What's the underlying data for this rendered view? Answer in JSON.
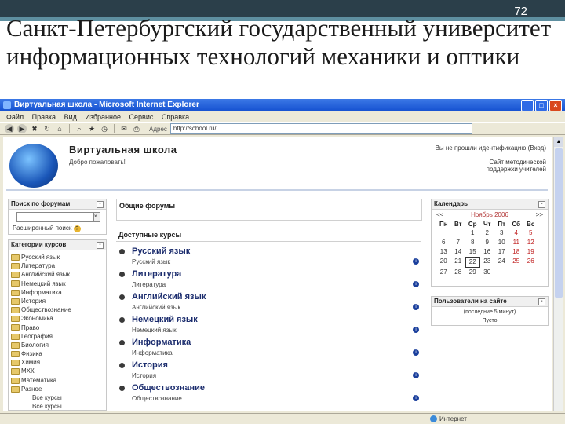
{
  "slide": {
    "number": "72",
    "title": "Санкт-Петербургский государственный университет информационных технологий механики и оптики"
  },
  "browser": {
    "window_title": "Виртуальная школа - Microsoft Internet Explorer",
    "menu": [
      "Файл",
      "Правка",
      "Вид",
      "Избранное",
      "Сервис",
      "Справка"
    ],
    "address_label": "Адрес",
    "address_value": "http://school.ru/",
    "status_zone": "Интернет"
  },
  "site": {
    "title": "Виртуальная школа",
    "welcome": "Добро пожаловать!",
    "login_info": "Вы не прошли идентификацию (Вход)",
    "support_link": "Сайт методической поддержки учителей"
  },
  "search_block": {
    "title": "Поиск по форумам",
    "go": "»",
    "advanced": "Расширенный поиск"
  },
  "categories_block": {
    "title": "Категории курсов",
    "items": [
      "Русский язык",
      "Литература",
      "Английский язык",
      "Немецкий язык",
      "Информатика",
      "История",
      "Обществознание",
      "Экономика",
      "Право",
      "География",
      "Биология",
      "Физика",
      "Химия",
      "МХК",
      "Математика",
      "Разное"
    ],
    "sub_items": [
      "Все курсы",
      "Все курсы..."
    ]
  },
  "center": {
    "forums_title": "Общие форумы",
    "courses_title": "Доступные курсы",
    "courses": [
      {
        "name": "Русский язык",
        "desc": "Русский язык"
      },
      {
        "name": "Литература",
        "desc": "Литература"
      },
      {
        "name": "Английский язык",
        "desc": "Английский язык"
      },
      {
        "name": "Немецкий язык",
        "desc": "Немецкий язык"
      },
      {
        "name": "Информатика",
        "desc": "Информатика"
      },
      {
        "name": "История",
        "desc": "История"
      },
      {
        "name": "Обществознание",
        "desc": "Обществознание"
      }
    ]
  },
  "calendar": {
    "title": "Календарь",
    "prev": "<<",
    "month": "Ноябрь 2006",
    "next": ">>",
    "day_headers": [
      "Пн",
      "Вт",
      "Ср",
      "Чт",
      "Пт",
      "Сб",
      "Вс"
    ],
    "weeks": [
      [
        "",
        "",
        "1",
        "2",
        "3",
        "4",
        "5"
      ],
      [
        "6",
        "7",
        "8",
        "9",
        "10",
        "11",
        "12"
      ],
      [
        "13",
        "14",
        "15",
        "16",
        "17",
        "18",
        "19"
      ],
      [
        "20",
        "21",
        "22",
        "23",
        "24",
        "25",
        "26"
      ],
      [
        "27",
        "28",
        "29",
        "30",
        "",
        "",
        ""
      ]
    ],
    "today": "22"
  },
  "users_block": {
    "title": "Пользователи на сайте",
    "text": "(последние 5 минут)",
    "empty": "Пусто"
  }
}
